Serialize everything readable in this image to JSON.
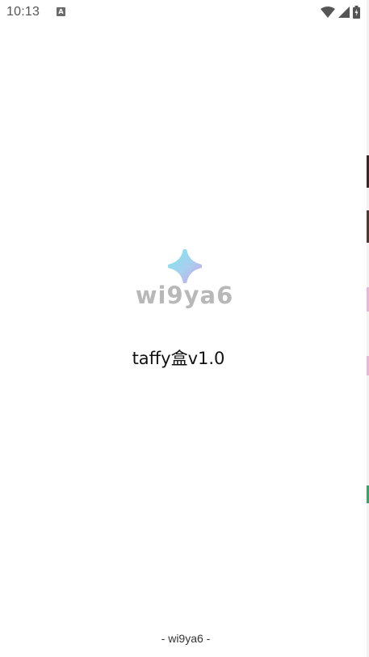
{
  "status_bar": {
    "time": "10:13",
    "notification_icon": "a-letter-icon",
    "notification_letter": "A",
    "icons": [
      "wifi-icon",
      "signal-icon",
      "battery-charging-icon"
    ]
  },
  "splash": {
    "logo_icon": "sparkle-star-icon",
    "logo_text": "wi9ya6",
    "app_title": "taffy盒v1.0"
  },
  "footer": {
    "text": "- wi9ya6  -"
  },
  "colors": {
    "background": "#ffffff",
    "logo_text": "#b8b8b8",
    "logo_gradient_start": "#7fe6ee",
    "logo_gradient_end": "#c7a6e6",
    "status_text": "#555555"
  }
}
